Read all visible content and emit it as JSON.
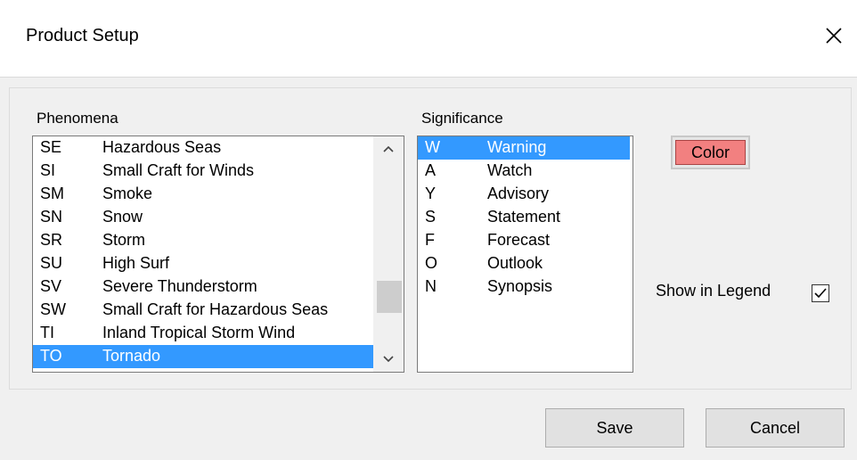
{
  "dialog": {
    "title": "Product Setup"
  },
  "phenomena": {
    "label": "Phenomena",
    "items": [
      {
        "code": "SE",
        "name": "Hazardous Seas",
        "selected": false
      },
      {
        "code": "SI",
        "name": "Small Craft for Winds",
        "selected": false
      },
      {
        "code": "SM",
        "name": "Smoke",
        "selected": false
      },
      {
        "code": "SN",
        "name": "Snow",
        "selected": false
      },
      {
        "code": "SR",
        "name": "Storm",
        "selected": false
      },
      {
        "code": "SU",
        "name": "High Surf",
        "selected": false
      },
      {
        "code": "SV",
        "name": "Severe Thunderstorm",
        "selected": false
      },
      {
        "code": "SW",
        "name": "Small Craft for Hazardous Seas",
        "selected": false
      },
      {
        "code": "TI",
        "name": "Inland Tropical Storm Wind",
        "selected": false
      },
      {
        "code": "TO",
        "name": "Tornado",
        "selected": true
      }
    ]
  },
  "significance": {
    "label": "Significance",
    "items": [
      {
        "code": "W",
        "name": "Warning",
        "selected": true
      },
      {
        "code": "A",
        "name": "Watch",
        "selected": false
      },
      {
        "code": "Y",
        "name": "Advisory",
        "selected": false
      },
      {
        "code": "S",
        "name": "Statement",
        "selected": false
      },
      {
        "code": "F",
        "name": "Forecast",
        "selected": false
      },
      {
        "code": "O",
        "name": "Outlook",
        "selected": false
      },
      {
        "code": "N",
        "name": "Synopsis",
        "selected": false
      }
    ]
  },
  "color_button": {
    "label": "Color",
    "swatch": "#f28080"
  },
  "legend": {
    "label": "Show in Legend",
    "checked": true
  },
  "buttons": {
    "save": "Save",
    "cancel": "Cancel"
  },
  "colors": {
    "selection": "#3399ff"
  }
}
